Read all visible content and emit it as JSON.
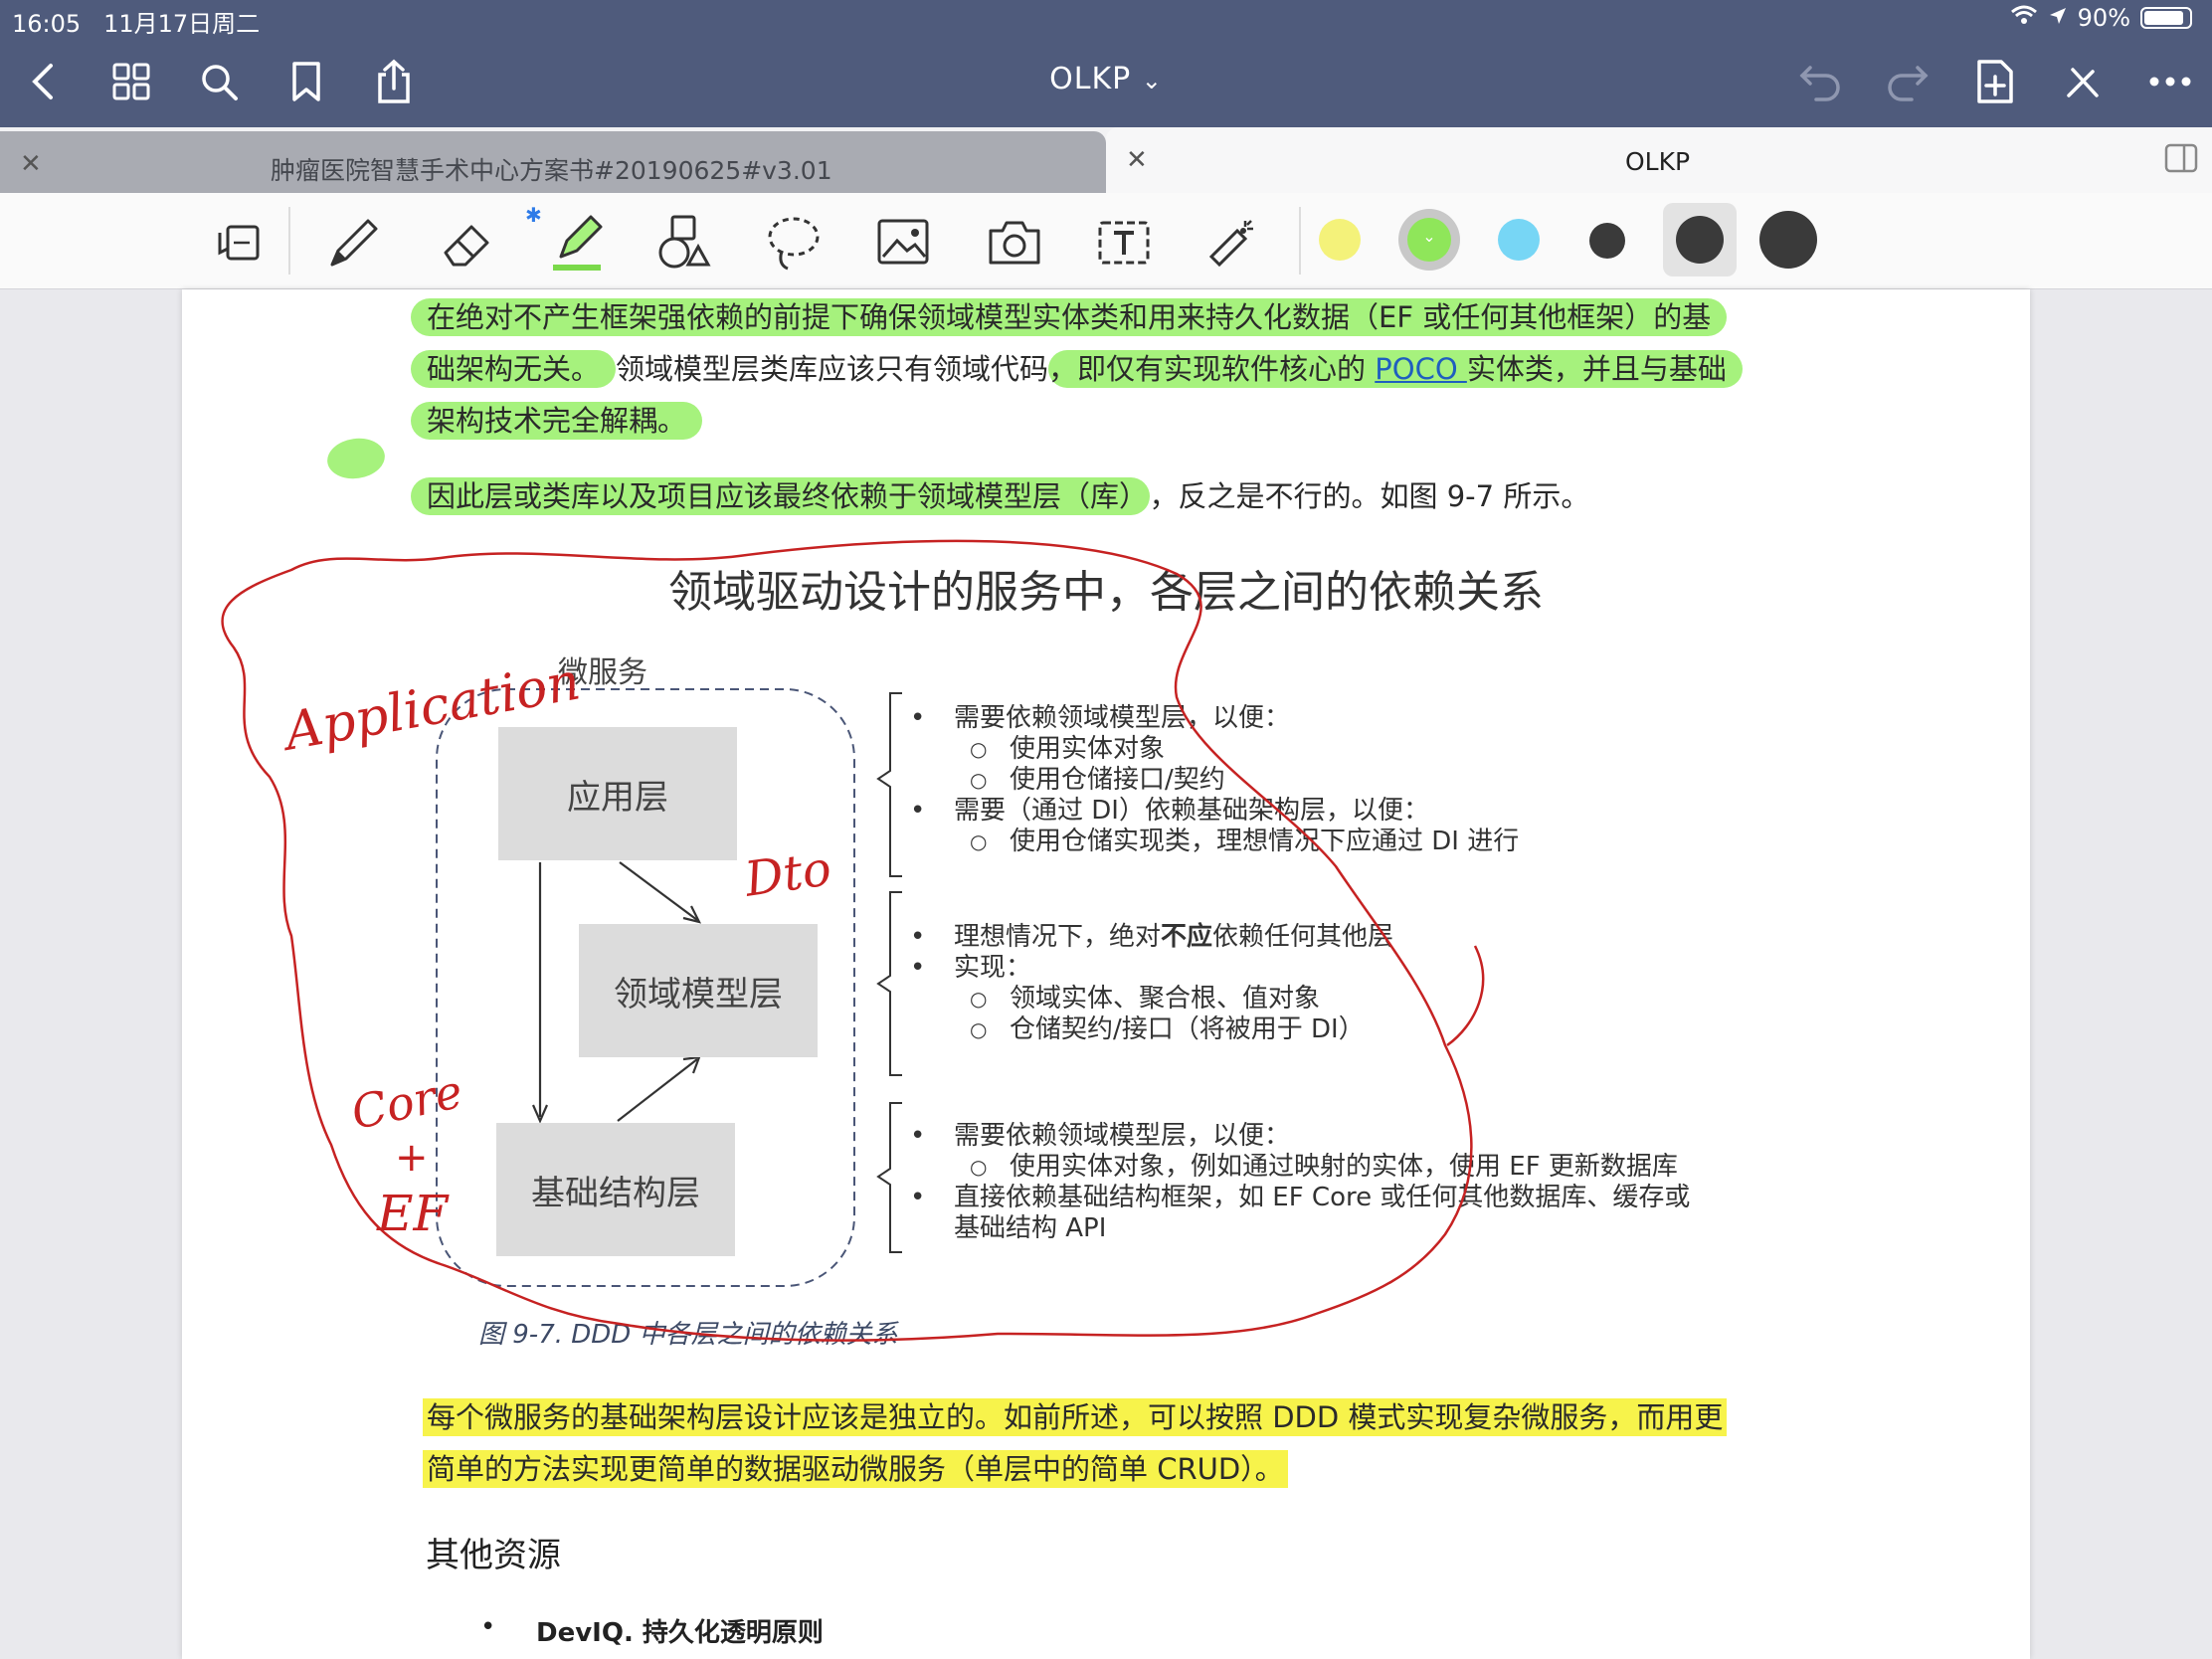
{
  "status": {
    "time": "16:05",
    "date": "11月17日周二",
    "battery": "90%",
    "battery_level": 0.9
  },
  "nav": {
    "title": "OLKP",
    "title_chevron": "⌄"
  },
  "tabs": [
    {
      "label": "肿瘤医院智慧手术中心方案书#20190625#v3.01",
      "active": false
    },
    {
      "label": "OLKP",
      "active": true
    }
  ],
  "toolbar": {
    "tools": [
      "page-view-icon",
      "pen-icon",
      "eraser-icon",
      "highlighter-icon",
      "shapes-icon",
      "lasso-icon",
      "image-icon",
      "camera-icon",
      "text-icon",
      "laser-pointer-icon"
    ],
    "color_swatches": [
      "#f4f27a",
      "#8fe65a",
      "#77d6f5",
      "#3a3a3a"
    ],
    "stroke_swatches": [
      "#3a3a3a",
      "#3a3a3a"
    ],
    "selected_color": "#8fe65a"
  },
  "document": {
    "para1": {
      "l1": "在绝对不产生框架强依赖的前提下确保领域模型实体类和用来持久化数据（EF 或任何其他框架）的基",
      "l2a": "础架构无关。",
      "l2b": "领域模型层类库应该只有领域代码",
      "l2c": "，即仅有实现软件核心的 ",
      "l2link": "POCO ",
      "l2d": "实体类，并且与基础",
      "l3": "架构技术完全解耦。"
    },
    "para2": {
      "a": "因此层或类库以及项目应该最终依赖于领域模型层（库）",
      "b": "，反之是不行的。如图 9-7 所示。"
    },
    "diagram": {
      "title": "领域驱动设计的服务中，各层之间的依赖关系",
      "container_label": "微服务",
      "boxes": {
        "app": "应用层",
        "domain": "领域模型层",
        "infra": "基础结构层"
      },
      "group1": [
        {
          "level": 1,
          "text": "需要依赖领域模型层，以便："
        },
        {
          "level": 2,
          "text": "使用实体对象"
        },
        {
          "level": 2,
          "text": "使用仓储接口/契约"
        },
        {
          "level": 1,
          "text": "需要（通过 DI）依赖基础架构层，以便："
        },
        {
          "level": 2,
          "text": "使用仓储实现类，理想情况下应通过 DI 进行"
        }
      ],
      "group2_first_a": "理想情况下，绝对",
      "group2_first_bold": "不应",
      "group2_first_b": "依赖任何其他层",
      "group2": [
        {
          "level": 1,
          "text": "实现："
        },
        {
          "level": 2,
          "text": "领域实体、聚合根、值对象"
        },
        {
          "level": 2,
          "text": "仓储契约/接口（将被用于 DI）"
        }
      ],
      "group3": [
        {
          "level": 1,
          "text": "需要依赖领域模型层，以便："
        },
        {
          "level": 2,
          "text": "使用实体对象，例如通过映射的实体，使用 EF 更新数据库"
        },
        {
          "level": 1,
          "text": "直接依赖基础结构框架，如 EF Core 或任何其他数据库、缓存或"
        },
        {
          "level": 0,
          "text": "基础结构 API"
        }
      ],
      "caption": "图 9-7. DDD 中各层之间的依赖关系"
    },
    "annotations": {
      "application": "Application",
      "dto": "Dto",
      "core": "Core",
      "plus": "+",
      "ef": "EF"
    },
    "para3": {
      "l1": "每个微服务的基础架构层设计应该是独立的。如前所述，可以按照 DDD 模式实现复杂微服务，而用更",
      "l2": "简单的方法实现更简单的数据驱动微服务（单层中的简单 CRUD）。"
    },
    "section_title": "其他资源",
    "resources": [
      "DevIQ. 持久化透明原则"
    ]
  }
}
